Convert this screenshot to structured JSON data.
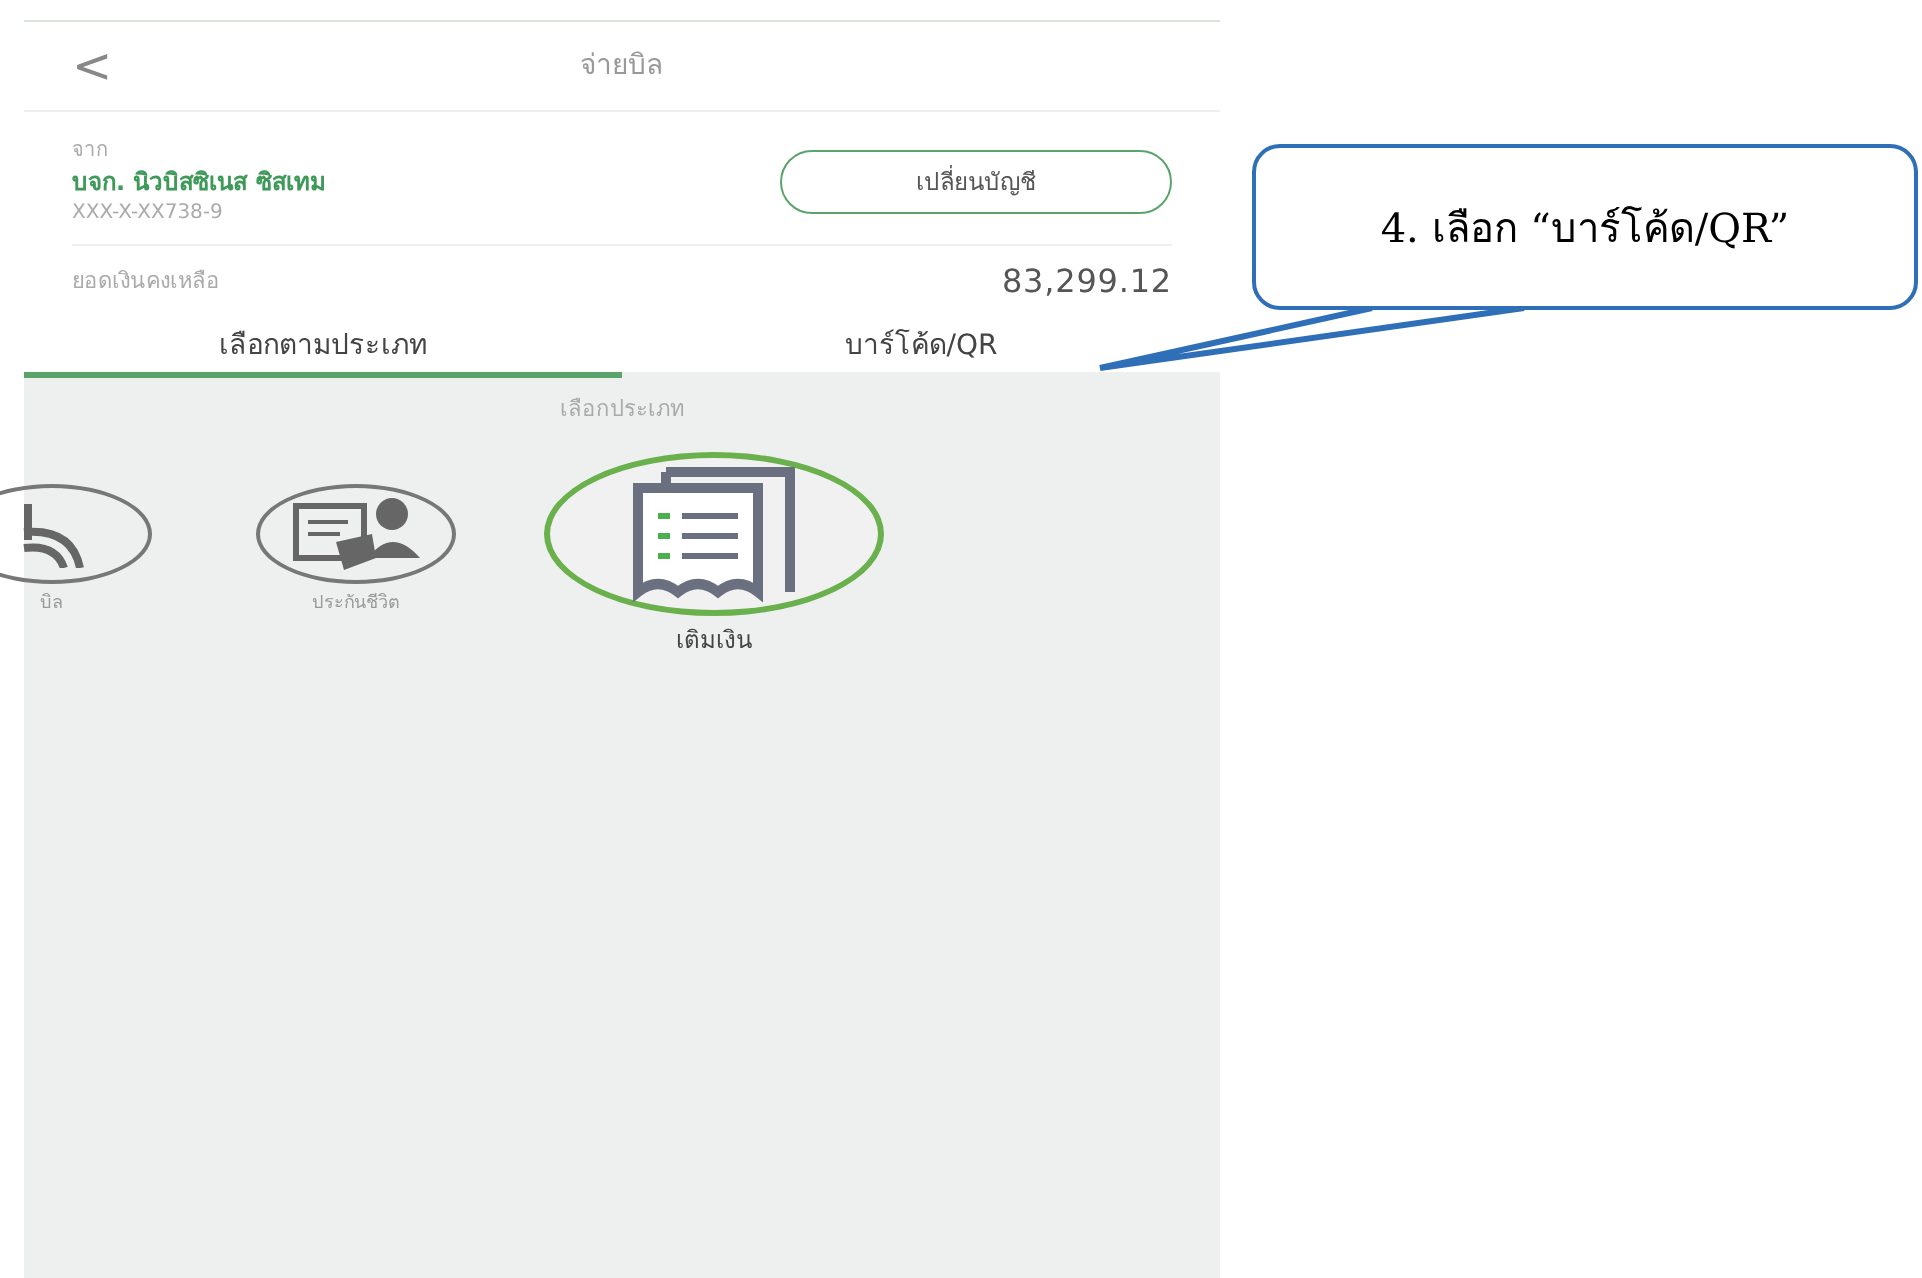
{
  "header": {
    "back": "<",
    "title": "จ่ายบิล"
  },
  "account": {
    "from_label": "จาก",
    "name": "บจก. นิวบิสซิเนส ซิสเทม",
    "number": "XXX-X-XX738-9",
    "change_button": "เปลี่ยนบัญชี",
    "balance_label": "ยอดเงินคงเหลือ",
    "balance": "83,299.12"
  },
  "tabs": [
    {
      "label": "เลือกตามประเภท",
      "selected": true
    },
    {
      "label": "บาร์โค้ด/QR",
      "selected": false
    }
  ],
  "category_heading": "เลือกประเภท",
  "categories": [
    {
      "kind": "signal",
      "label": "บิล",
      "selected": false
    },
    {
      "kind": "insurance",
      "label": "ประกันชีวิต",
      "selected": false
    },
    {
      "kind": "topup",
      "label": "เติมเงิน",
      "selected": true
    }
  ],
  "callout": {
    "text": "4. เลือก “บาร์โค้ด/QR”"
  }
}
